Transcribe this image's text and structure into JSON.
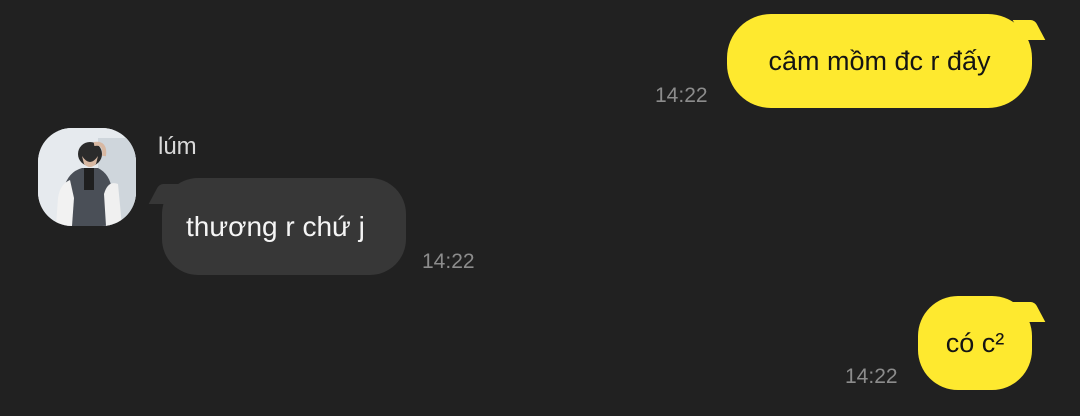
{
  "contact": {
    "name": "lúm"
  },
  "messages": [
    {
      "direction": "outgoing",
      "text": "câm mồm đc r đấy",
      "time": "14:22"
    },
    {
      "direction": "incoming",
      "text": "thương r chứ j",
      "time": "14:22"
    },
    {
      "direction": "outgoing",
      "text": "có c²",
      "time": "14:22"
    }
  ],
  "colors": {
    "background": "#212121",
    "outgoing_bubble": "#fee92f",
    "incoming_bubble": "#373737",
    "timestamp": "#8c8c8c"
  }
}
